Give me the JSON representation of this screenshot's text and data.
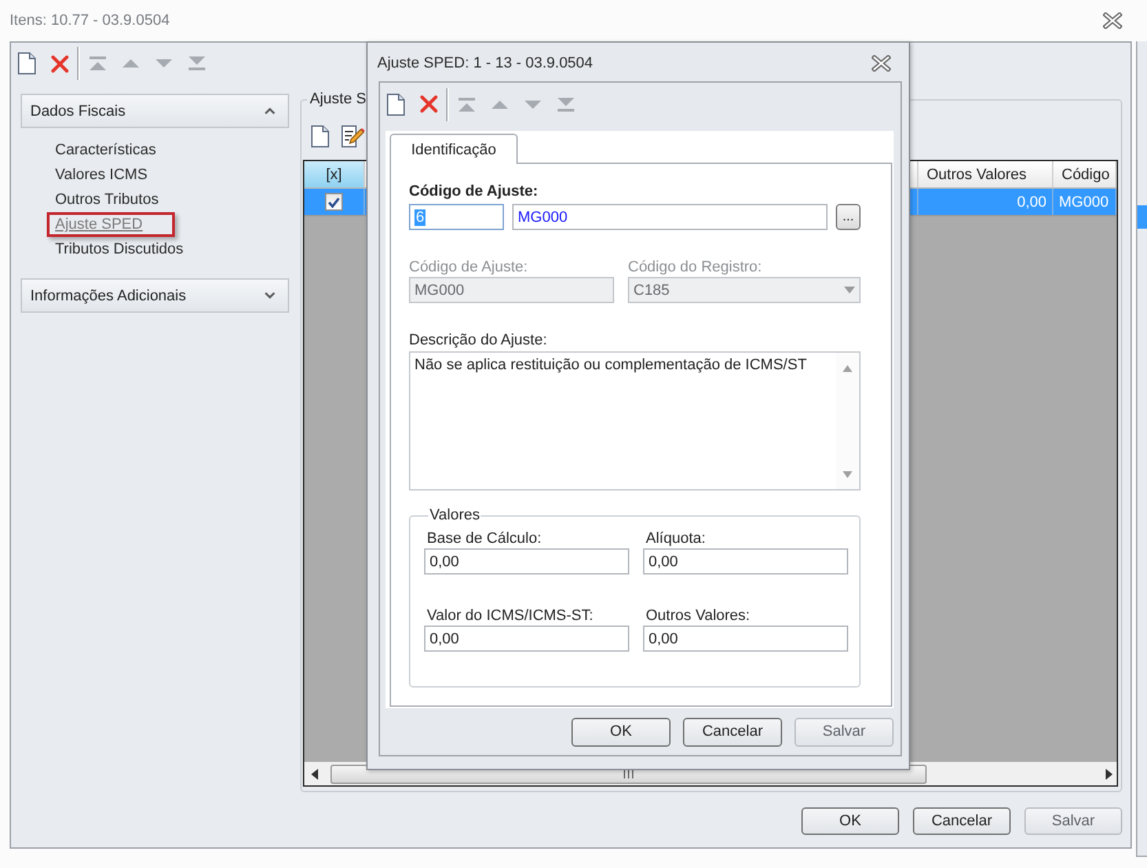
{
  "window": {
    "title": "Itens: 10.77 - 03.9.0504"
  },
  "sidebar": {
    "sections": [
      {
        "title": "Dados Fiscais",
        "expanded": true,
        "items": [
          {
            "label": "Características",
            "selected": false
          },
          {
            "label": "Valores ICMS",
            "selected": false
          },
          {
            "label": "Outros Tributos",
            "selected": false
          },
          {
            "label": "Ajuste SPED",
            "selected": true
          },
          {
            "label": "Tributos Discutidos",
            "selected": false
          }
        ]
      },
      {
        "title": "Informações Adicionais",
        "expanded": false
      }
    ]
  },
  "panel": {
    "title": "Ajuste S",
    "table": {
      "columns": [
        {
          "label": "[x]"
        },
        {
          "label": "Outros Valores"
        },
        {
          "label": "Código"
        }
      ],
      "rows": [
        {
          "selected": true,
          "cells": [
            {
              "kind": "checkbox",
              "checked": true
            },
            {
              "kind": "text",
              "text": "0,00"
            },
            {
              "kind": "text",
              "text": "MG000"
            }
          ]
        }
      ]
    }
  },
  "buttons": [
    {
      "label": "OK",
      "disabled": false
    },
    {
      "label": "Cancelar",
      "disabled": false
    },
    {
      "label": "Salvar",
      "disabled": true
    }
  ],
  "dialog": {
    "title": "Ajuste SPED: 1 - 13 - 03.9.0504",
    "tabs": [
      {
        "label": "Identificação",
        "selected": true
      }
    ],
    "lookup": {
      "label": "Código de Ajuste:",
      "code": "6",
      "code_focused": true,
      "name": "MG000",
      "button": "..."
    },
    "fields": [
      {
        "label": "Código de Ajuste:",
        "value": "MG000",
        "kind": "text",
        "disabled": true
      },
      {
        "label": "Código do Registro:",
        "value": "C185",
        "kind": "select",
        "disabled": true
      }
    ],
    "description": {
      "label": "Descrição do Ajuste:",
      "value": "Não se aplica restituição ou complementação de ICMS/ST"
    },
    "values_group": {
      "title": "Valores",
      "fields": [
        {
          "label": "Base de Cálculo:",
          "value": "0,00"
        },
        {
          "label": "Alíquota:",
          "value": "0,00"
        },
        {
          "label": "Valor do ICMS/ICMS-ST:",
          "value": "0,00"
        },
        {
          "label": "Outros Valores:",
          "value": "0,00"
        }
      ]
    },
    "buttons": [
      {
        "label": "OK",
        "disabled": false
      },
      {
        "label": "Cancelar",
        "disabled": false
      },
      {
        "label": "Salvar",
        "disabled": true
      }
    ]
  }
}
